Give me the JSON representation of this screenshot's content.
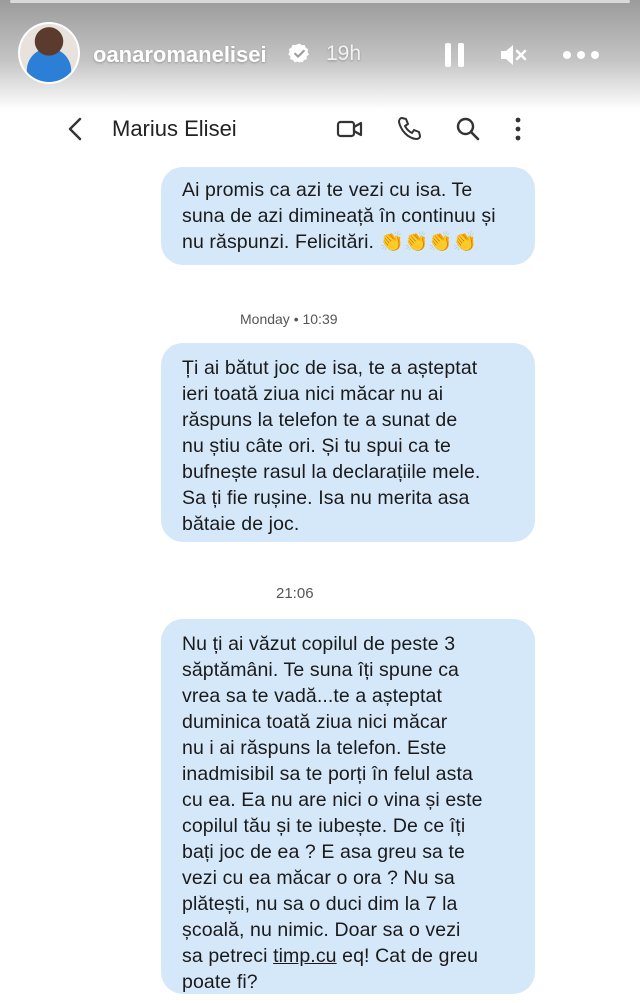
{
  "story": {
    "username": "oanaromanelisei",
    "time_ago": "19h",
    "progress_fraction": 1.0
  },
  "chat": {
    "contact_name": "Marius Elisei",
    "messages": [
      {
        "text": "Ai promis ca azi te vezi cu isa. Te\nsuna de azi dimineață în continuu și\nnu răspunzi. Felicitări. 👏👏👏👏"
      },
      {
        "timestamp": "Monday • 10:39",
        "text": "Ți ai bătut joc de isa, te a așteptat\nieri toată   ziua nici măcar nu ai\nrăspuns la telefon te a sunat de\nnu știu câte ori. Și tu spui ca te\nbufnește rasul la declarațiile mele.\nSa ți fie rușine. Isa nu merita asa\nbătaie de joc."
      },
      {
        "timestamp": "21:06",
        "text_before_link": "Nu ți ai văzut copilul de peste 3\nsăptămâni. Te suna îți spune ca\nvrea sa te vadă...te a așteptat\nduminica toată ziua nici măcar\nnu i ai răspuns la telefon. Este\ninadmisibil sa te porți în felul asta\ncu ea. Ea nu are nici o vina și este\ncopilul tău și te iubește. De ce îți\nbați joc de ea ? E asa greu sa te\nvezi cu ea măcar o ora ? Nu sa\nplătești, nu sa o duci dim la 7 la\nșcoală, nu nimic. Doar sa o vezi\nsa petreci ",
        "link": "timp.cu",
        "text_after_link": " eq! Cat de greu\npoate fi?"
      }
    ]
  },
  "icons": {
    "back": "chevron-left-icon",
    "video": "video-camera-icon",
    "phone": "phone-icon",
    "search": "search-icon",
    "more": "kebab-menu-icon",
    "pause": "pause-icon",
    "mute": "speaker-muted-icon",
    "story_more": "more-horizontal-icon",
    "verified": "verified-badge-icon"
  },
  "colors": {
    "bubble": "#d5e8f9",
    "verified": "#ffffff"
  }
}
